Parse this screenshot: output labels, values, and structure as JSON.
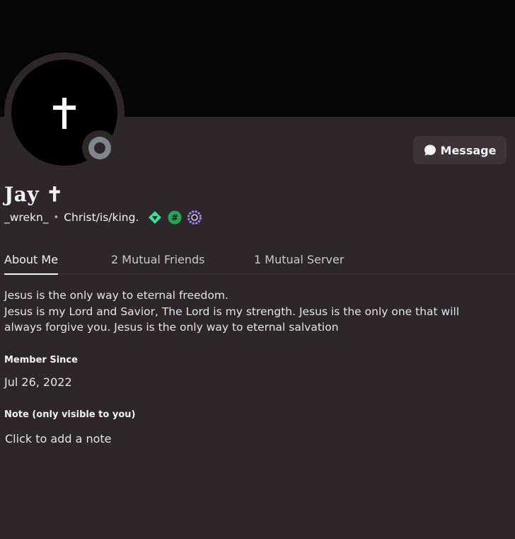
{
  "profile": {
    "display_name": "Jay ✝",
    "username": "_wrekn_",
    "separator": "•",
    "pronouns": "Christ/is/king.",
    "avatar_icon": "cross-icon",
    "status": "offline",
    "badges": [
      "hypesquad-balance-badge",
      "hashtag-badge",
      "nitro-laurel-badge"
    ]
  },
  "actions": {
    "message_label": "Message"
  },
  "tabs": [
    {
      "label": "About Me",
      "active": true
    },
    {
      "label": "2 Mutual Friends",
      "active": false
    },
    {
      "label": "1 Mutual Server",
      "active": false
    }
  ],
  "about": {
    "bio_line1": "Jesus is the only way to eternal freedom.",
    "bio_line2": "Jesus is my Lord and Savior, The Lord is my strength. Jesus is the only one that will always forgive you. Jesus is the only way to eternal salvation"
  },
  "member_since": {
    "label": "Member Since",
    "value": "Jul 26, 2022"
  },
  "note": {
    "label": "Note (only visible to you)",
    "placeholder": "Click to add a note"
  },
  "colors": {
    "background": "#2f2629",
    "banner": "#050505",
    "status_offline": "#80848e",
    "badge_green": "#3ddc97",
    "badge_purple": "#9b84ec"
  }
}
